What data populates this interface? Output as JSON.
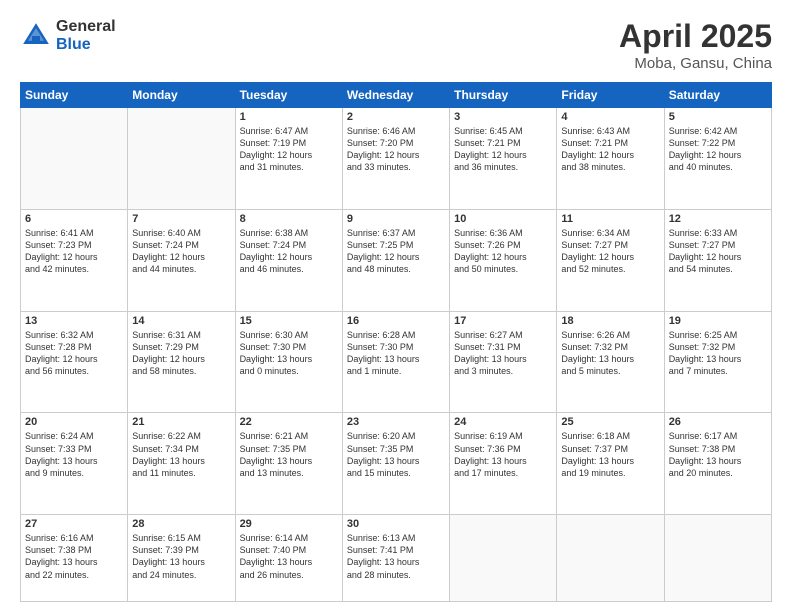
{
  "header": {
    "logo_general": "General",
    "logo_blue": "Blue",
    "title": "April 2025",
    "location": "Moba, Gansu, China"
  },
  "weekdays": [
    "Sunday",
    "Monday",
    "Tuesday",
    "Wednesday",
    "Thursday",
    "Friday",
    "Saturday"
  ],
  "weeks": [
    [
      {
        "num": "",
        "info": ""
      },
      {
        "num": "",
        "info": ""
      },
      {
        "num": "1",
        "info": "Sunrise: 6:47 AM\nSunset: 7:19 PM\nDaylight: 12 hours\nand 31 minutes."
      },
      {
        "num": "2",
        "info": "Sunrise: 6:46 AM\nSunset: 7:20 PM\nDaylight: 12 hours\nand 33 minutes."
      },
      {
        "num": "3",
        "info": "Sunrise: 6:45 AM\nSunset: 7:21 PM\nDaylight: 12 hours\nand 36 minutes."
      },
      {
        "num": "4",
        "info": "Sunrise: 6:43 AM\nSunset: 7:21 PM\nDaylight: 12 hours\nand 38 minutes."
      },
      {
        "num": "5",
        "info": "Sunrise: 6:42 AM\nSunset: 7:22 PM\nDaylight: 12 hours\nand 40 minutes."
      }
    ],
    [
      {
        "num": "6",
        "info": "Sunrise: 6:41 AM\nSunset: 7:23 PM\nDaylight: 12 hours\nand 42 minutes."
      },
      {
        "num": "7",
        "info": "Sunrise: 6:40 AM\nSunset: 7:24 PM\nDaylight: 12 hours\nand 44 minutes."
      },
      {
        "num": "8",
        "info": "Sunrise: 6:38 AM\nSunset: 7:24 PM\nDaylight: 12 hours\nand 46 minutes."
      },
      {
        "num": "9",
        "info": "Sunrise: 6:37 AM\nSunset: 7:25 PM\nDaylight: 12 hours\nand 48 minutes."
      },
      {
        "num": "10",
        "info": "Sunrise: 6:36 AM\nSunset: 7:26 PM\nDaylight: 12 hours\nand 50 minutes."
      },
      {
        "num": "11",
        "info": "Sunrise: 6:34 AM\nSunset: 7:27 PM\nDaylight: 12 hours\nand 52 minutes."
      },
      {
        "num": "12",
        "info": "Sunrise: 6:33 AM\nSunset: 7:27 PM\nDaylight: 12 hours\nand 54 minutes."
      }
    ],
    [
      {
        "num": "13",
        "info": "Sunrise: 6:32 AM\nSunset: 7:28 PM\nDaylight: 12 hours\nand 56 minutes."
      },
      {
        "num": "14",
        "info": "Sunrise: 6:31 AM\nSunset: 7:29 PM\nDaylight: 12 hours\nand 58 minutes."
      },
      {
        "num": "15",
        "info": "Sunrise: 6:30 AM\nSunset: 7:30 PM\nDaylight: 13 hours\nand 0 minutes."
      },
      {
        "num": "16",
        "info": "Sunrise: 6:28 AM\nSunset: 7:30 PM\nDaylight: 13 hours\nand 1 minute."
      },
      {
        "num": "17",
        "info": "Sunrise: 6:27 AM\nSunset: 7:31 PM\nDaylight: 13 hours\nand 3 minutes."
      },
      {
        "num": "18",
        "info": "Sunrise: 6:26 AM\nSunset: 7:32 PM\nDaylight: 13 hours\nand 5 minutes."
      },
      {
        "num": "19",
        "info": "Sunrise: 6:25 AM\nSunset: 7:32 PM\nDaylight: 13 hours\nand 7 minutes."
      }
    ],
    [
      {
        "num": "20",
        "info": "Sunrise: 6:24 AM\nSunset: 7:33 PM\nDaylight: 13 hours\nand 9 minutes."
      },
      {
        "num": "21",
        "info": "Sunrise: 6:22 AM\nSunset: 7:34 PM\nDaylight: 13 hours\nand 11 minutes."
      },
      {
        "num": "22",
        "info": "Sunrise: 6:21 AM\nSunset: 7:35 PM\nDaylight: 13 hours\nand 13 minutes."
      },
      {
        "num": "23",
        "info": "Sunrise: 6:20 AM\nSunset: 7:35 PM\nDaylight: 13 hours\nand 15 minutes."
      },
      {
        "num": "24",
        "info": "Sunrise: 6:19 AM\nSunset: 7:36 PM\nDaylight: 13 hours\nand 17 minutes."
      },
      {
        "num": "25",
        "info": "Sunrise: 6:18 AM\nSunset: 7:37 PM\nDaylight: 13 hours\nand 19 minutes."
      },
      {
        "num": "26",
        "info": "Sunrise: 6:17 AM\nSunset: 7:38 PM\nDaylight: 13 hours\nand 20 minutes."
      }
    ],
    [
      {
        "num": "27",
        "info": "Sunrise: 6:16 AM\nSunset: 7:38 PM\nDaylight: 13 hours\nand 22 minutes."
      },
      {
        "num": "28",
        "info": "Sunrise: 6:15 AM\nSunset: 7:39 PM\nDaylight: 13 hours\nand 24 minutes."
      },
      {
        "num": "29",
        "info": "Sunrise: 6:14 AM\nSunset: 7:40 PM\nDaylight: 13 hours\nand 26 minutes."
      },
      {
        "num": "30",
        "info": "Sunrise: 6:13 AM\nSunset: 7:41 PM\nDaylight: 13 hours\nand 28 minutes."
      },
      {
        "num": "",
        "info": ""
      },
      {
        "num": "",
        "info": ""
      },
      {
        "num": "",
        "info": ""
      }
    ]
  ]
}
